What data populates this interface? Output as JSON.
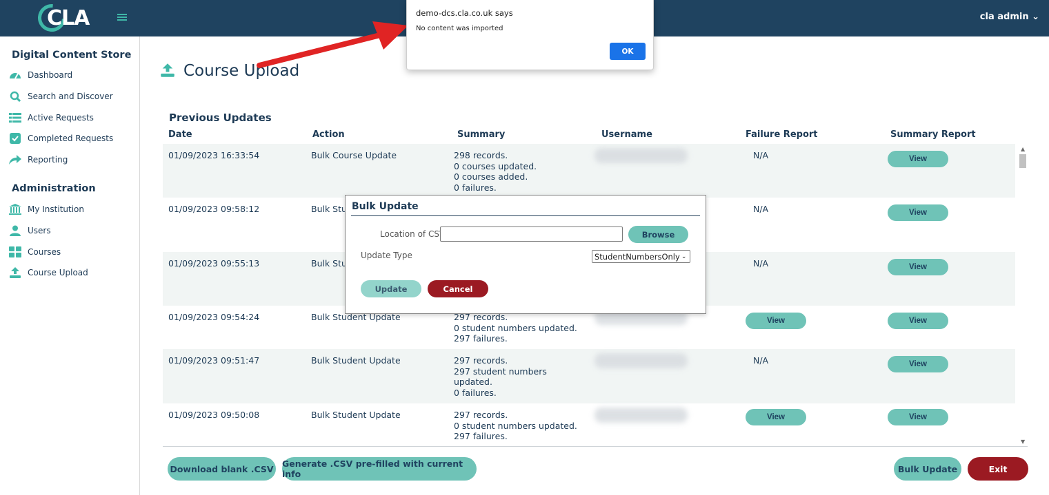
{
  "header": {
    "logo_text": "CLA",
    "user_menu": "cla admin ⌄"
  },
  "sidebar": {
    "section1": "Digital Content Store",
    "section1_items": [
      {
        "label": "Dashboard",
        "icon": "dashboard-icon"
      },
      {
        "label": "Search and Discover",
        "icon": "search-icon"
      },
      {
        "label": "Active Requests",
        "icon": "list-icon"
      },
      {
        "label": "Completed Requests",
        "icon": "checkbox-icon"
      },
      {
        "label": "Reporting",
        "icon": "share-arrow-icon"
      }
    ],
    "section2": "Administration",
    "section2_items": [
      {
        "label": "My Institution",
        "icon": "institution-icon"
      },
      {
        "label": "Users",
        "icon": "user-icon"
      },
      {
        "label": "Courses",
        "icon": "grid-icon"
      },
      {
        "label": "Course Upload",
        "icon": "upload-icon"
      }
    ]
  },
  "page": {
    "title": "Course Upload",
    "prev_updates": "Previous Updates"
  },
  "table": {
    "headers": [
      "Date",
      "Action",
      "Summary",
      "Username",
      "Failure Report",
      "Summary Report"
    ],
    "rows": [
      {
        "date": "01/09/2023 16:33:54",
        "action": "Bulk Course Update",
        "summary": [
          "298 records.",
          "0 courses updated.",
          "0 courses added.",
          "0 failures."
        ],
        "failure": "N/A",
        "report": "View"
      },
      {
        "date": "01/09/2023 09:58:12",
        "action": "Bulk Student Update",
        "summary": [],
        "failure": "N/A",
        "report": "View"
      },
      {
        "date": "01/09/2023 09:55:13",
        "action": "Bulk Student Update",
        "summary": [],
        "failure": "N/A",
        "report": "View"
      },
      {
        "date": "01/09/2023 09:54:24",
        "action": "Bulk Student Update",
        "summary": [
          "297 records.",
          "0 student numbers updated.",
          "297 failures."
        ],
        "failure": "View",
        "report": "View"
      },
      {
        "date": "01/09/2023 09:51:47",
        "action": "Bulk Student Update",
        "summary": [
          "297 records.",
          "297 student numbers",
          "updated.",
          "0 failures."
        ],
        "failure": "N/A",
        "report": "View"
      },
      {
        "date": "01/09/2023 09:50:08",
        "action": "Bulk Student Update",
        "summary": [
          "297 records.",
          "0 student numbers updated.",
          "297 failures."
        ],
        "failure": "View",
        "report": "View"
      }
    ]
  },
  "buttons": {
    "download_blank": "Download blank .CSV",
    "generate_prefilled": "Generate .CSV pre-filled with current info",
    "bulk_update": "Bulk Update",
    "exit": "Exit"
  },
  "modal": {
    "title": "Bulk Update",
    "csv_label": "Location of CSV file:",
    "browse": "Browse",
    "update_type_label": "Update Type",
    "update_type_value": "StudentNumbersOnly",
    "update": "Update",
    "cancel": "Cancel"
  },
  "alert": {
    "title": "demo-dcs.cla.co.uk says",
    "message": "No content was imported",
    "ok": "OK"
  },
  "colors": {
    "header": "#1f4360",
    "teal": "#6fc3b7",
    "dark_red": "#9b1a22",
    "alert_blue": "#1a73e8",
    "annotation_arrow": "#e02424"
  }
}
